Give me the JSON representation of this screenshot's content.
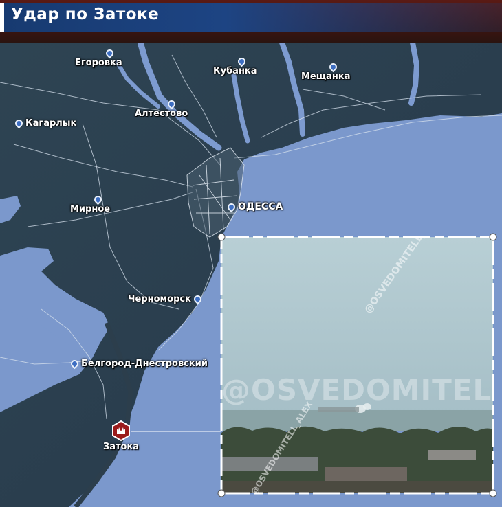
{
  "title": "Удар по Затоке",
  "places": [
    {
      "label": "Егоровка"
    },
    {
      "label": "Кубанка"
    },
    {
      "label": "Мещанка"
    },
    {
      "label": "Алтестово"
    },
    {
      "label": "Кагарлык"
    },
    {
      "label": "ОДЕССА"
    },
    {
      "label": "Мирное"
    },
    {
      "label": "Черноморск"
    },
    {
      "label": "Белгород-Днестровский"
    }
  ],
  "strike": {
    "label": "Затока",
    "icon": "explosion-icon",
    "color": "#9b1b1b"
  },
  "inset_photo": {
    "watermarks": [
      "@OSVEDOMITELL_ALEX",
      "@OSVEDOMITELL_AL",
      "@OSVEDOMITELL_ALEX"
    ]
  },
  "colors": {
    "sea": "#7b98cc",
    "land": "#2c3e4c",
    "rivers": "#7d9bd0",
    "title_bar": "#1d4483"
  }
}
